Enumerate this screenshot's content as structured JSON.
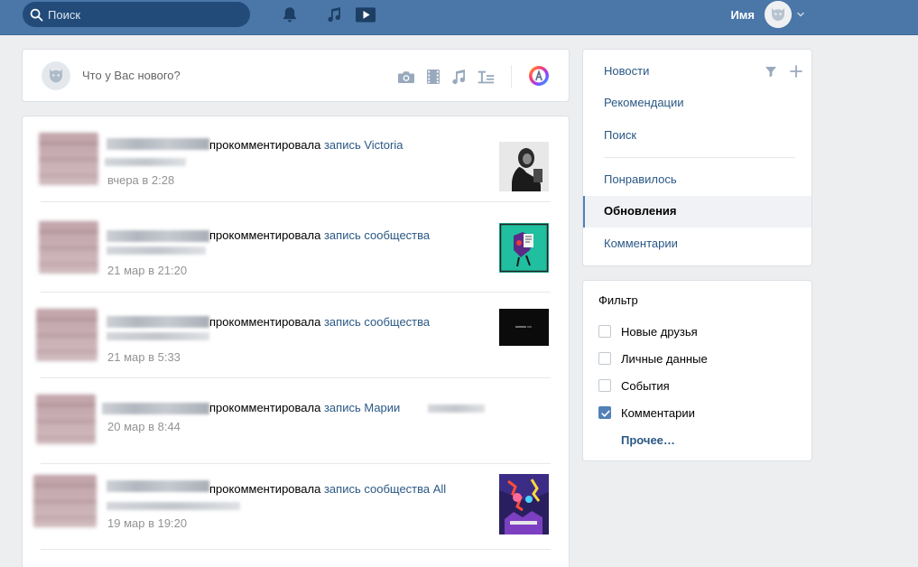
{
  "header": {
    "search_placeholder": "Поиск",
    "user_name": "Имя",
    "icons": [
      "search-icon",
      "bell-icon",
      "music-icon",
      "video-icon",
      "chevron-down-icon"
    ]
  },
  "composer": {
    "placeholder": "Что у Вас нового?",
    "tools": [
      "camera-icon",
      "film-icon",
      "music-icon",
      "text-format-icon",
      "color-palette-icon"
    ]
  },
  "feed": {
    "items": [
      {
        "action": "прокомментировала",
        "link": "запись Victoria",
        "date": "вчера в 2:28",
        "thumb": "photo-portrait"
      },
      {
        "action": "прокомментировала",
        "link": "запись сообщества",
        "date": "21 мар в 21:20",
        "thumb": "illustration"
      },
      {
        "action": "прокомментировала",
        "link": "запись сообщества",
        "date": "21 мар в 5:33",
        "thumb": "dark-frame"
      },
      {
        "action": "прокомментировала",
        "link": "запись Марии",
        "date": "20 мар в 8:44",
        "thumb": ""
      },
      {
        "action": "прокомментировала",
        "link": "запись сообщества All",
        "date": "19 мар в 19:20",
        "thumb": "poster"
      }
    ]
  },
  "right_nav": {
    "items": [
      {
        "label": "Новости"
      },
      {
        "label": "Рекомендации"
      },
      {
        "label": "Поиск"
      },
      {
        "label": "Понравилось"
      },
      {
        "label": "Обновления",
        "active": true
      },
      {
        "label": "Комментарии"
      }
    ]
  },
  "filter": {
    "title": "Фильтр",
    "options": [
      {
        "label": "Новые друзья",
        "checked": false
      },
      {
        "label": "Личные данные",
        "checked": false
      },
      {
        "label": "События",
        "checked": false
      },
      {
        "label": "Комментарии",
        "checked": true
      }
    ],
    "more": "Прочее…"
  },
  "colors": {
    "header_bg": "#4a76a8",
    "link": "#2a5885",
    "accent": "#5181b8",
    "page_bg": "#edeef0"
  }
}
